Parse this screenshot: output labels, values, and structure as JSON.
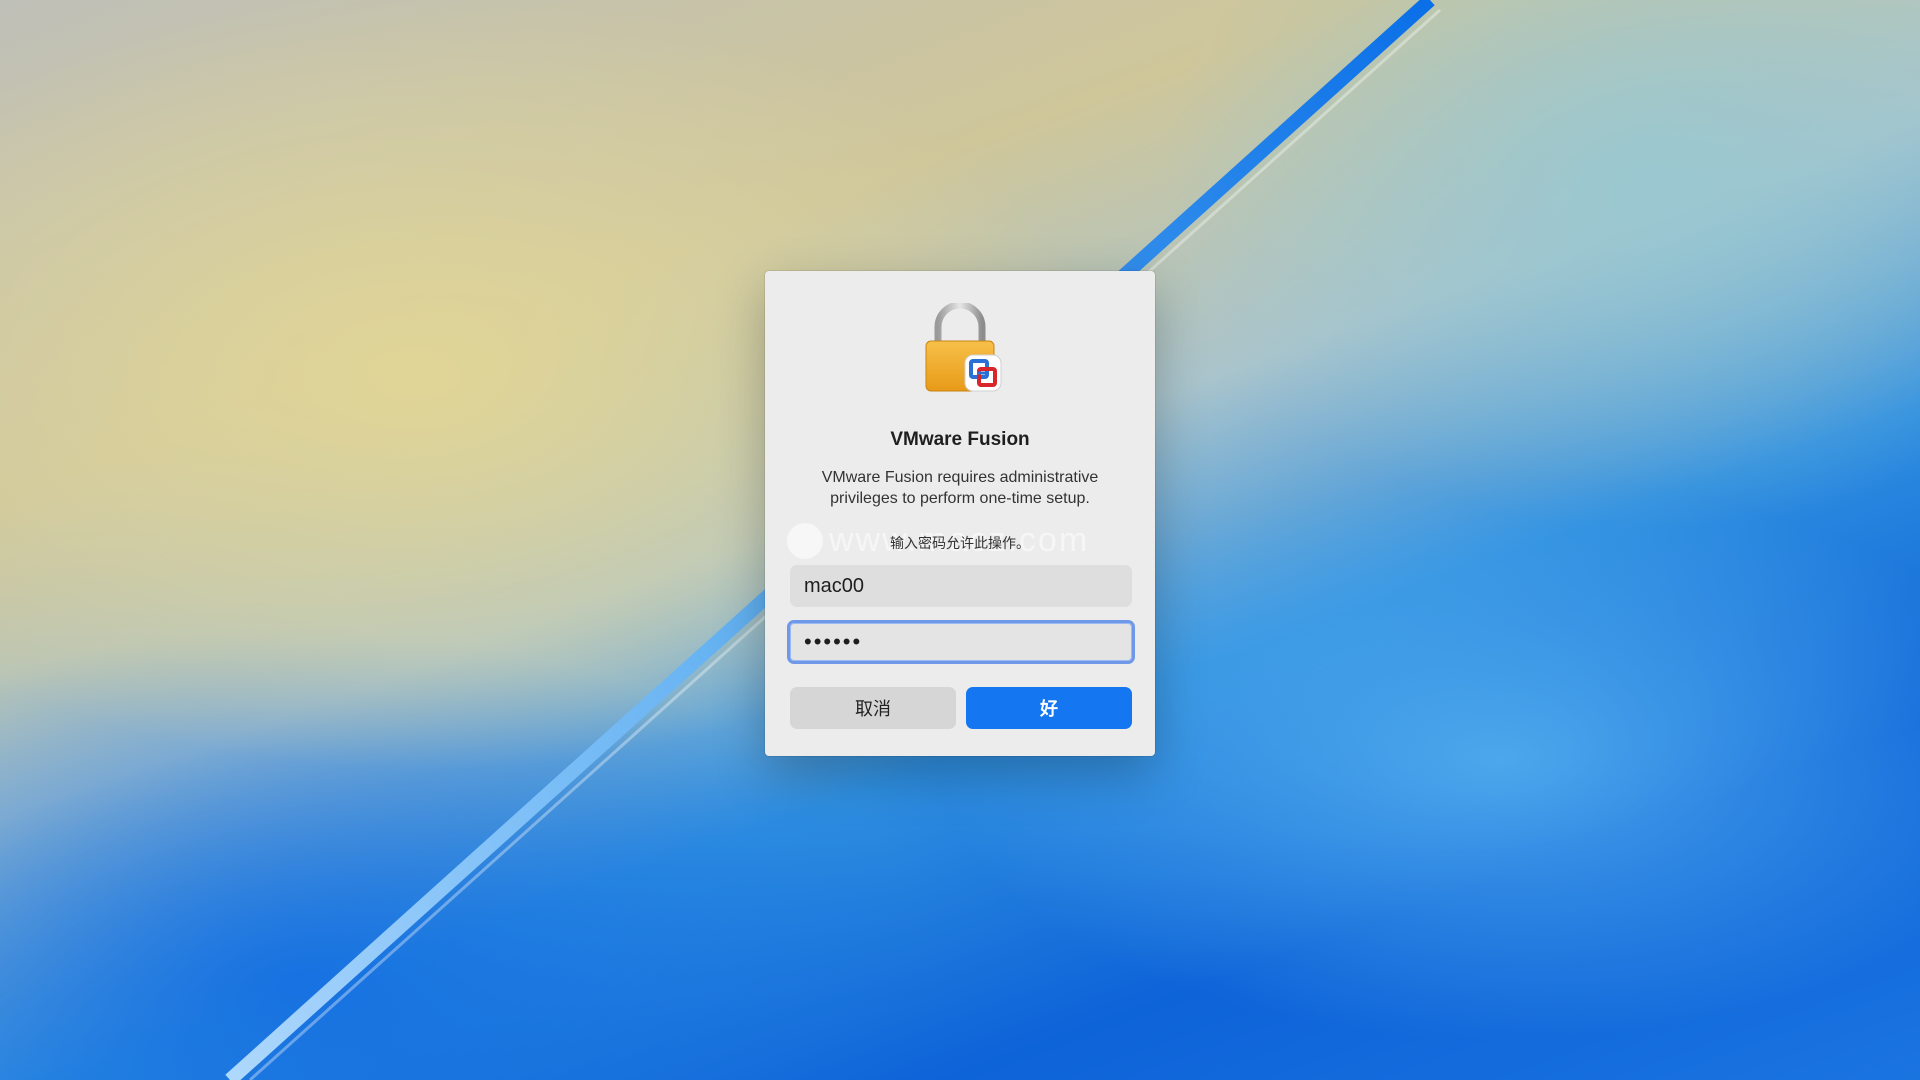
{
  "dialog": {
    "title": "VMware Fusion",
    "description_line1": "VMware Fusion requires administrative",
    "description_line2": "privileges to perform one-time setup.",
    "prompt": "输入密码允许此操作。",
    "username_value": "mac00",
    "password_value": "••••••",
    "cancel_label": "取消",
    "ok_label": "好"
  },
  "watermark": {
    "text": "www.macz.com"
  },
  "icons": {
    "dialog_icon": "lock-icon",
    "app_badge": "vmware-fusion-icon"
  },
  "colors": {
    "accent": "#1476f0",
    "focus_ring": "#6f98e8",
    "dialog_bg": "#ececec"
  }
}
